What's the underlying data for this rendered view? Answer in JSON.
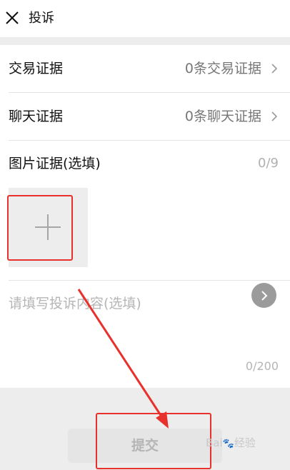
{
  "header": {
    "title": "投诉",
    "close_icon": "close-icon"
  },
  "evidence_rows": [
    {
      "label": "交易证据",
      "value": "0条交易证据",
      "icon": "chevron-right-icon"
    },
    {
      "label": "聊天证据",
      "value": "0条聊天证据",
      "icon": "chevron-right-icon"
    }
  ],
  "picture_section": {
    "label": "图片证据(选填)",
    "count": "0/9",
    "add_icon": "plus-icon"
  },
  "complaint_text": {
    "placeholder": "请填写投诉内容(选填)",
    "count": "0/200",
    "value": ""
  },
  "submit": {
    "label": "提交"
  },
  "watermark": {
    "text": "Bai",
    "paw": "🐾",
    "suffix": "经验"
  },
  "colors": {
    "annotation": "#e8312c",
    "background": "#ededed",
    "panel": "#ffffff"
  }
}
